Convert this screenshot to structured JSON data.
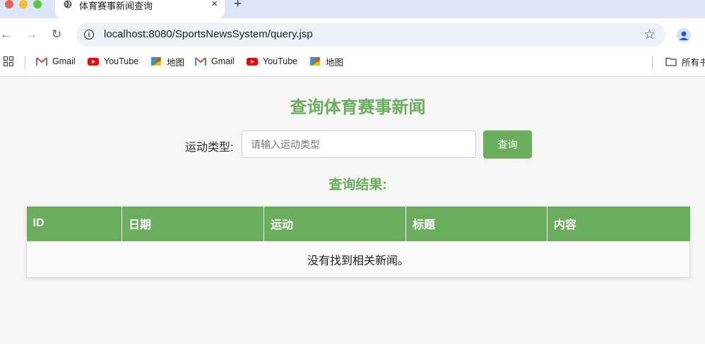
{
  "browser": {
    "tab_title": "体育赛事新闻查询",
    "tab_close": "×",
    "new_tab": "+",
    "url": "localhost:8080/SportsNewsSystem/query.jsp",
    "bookmarks": [
      {
        "label": "Gmail",
        "icon": "gmail-icon"
      },
      {
        "label": "YouTube",
        "icon": "youtube-icon"
      },
      {
        "label": "地图",
        "icon": "maps-icon"
      },
      {
        "label": "Gmail",
        "icon": "gmail-icon"
      },
      {
        "label": "YouTube",
        "icon": "youtube-icon"
      },
      {
        "label": "地图",
        "icon": "maps-icon"
      }
    ],
    "all_bookmarks": "所有书签"
  },
  "page": {
    "title": "查询体育赛事新闻",
    "sport_label": "运动类型:",
    "sport_input_value": "",
    "sport_input_placeholder": "请输入运动类型",
    "query_button": "查询",
    "result_title": "查询结果:",
    "table_headers": [
      "ID",
      "日期",
      "运动",
      "标题",
      "内容"
    ],
    "empty_message": "没有找到相关新闻。"
  },
  "colors": {
    "accent": "#6aae5d",
    "page_background": "#f6f6f6",
    "tabstrip": "#dde6f8"
  }
}
